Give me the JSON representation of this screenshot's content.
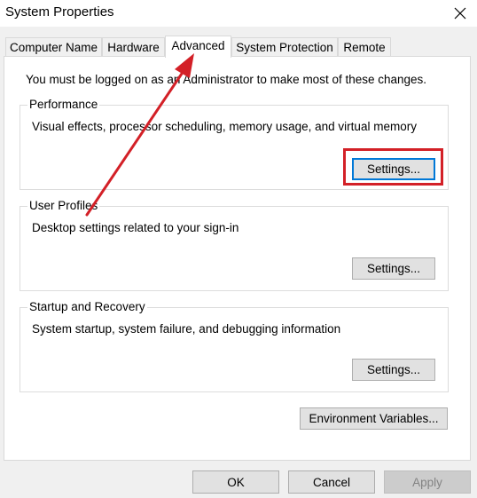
{
  "window": {
    "title": "System Properties",
    "close_icon": "close-icon"
  },
  "tabs": [
    {
      "label": "Computer Name",
      "active": false
    },
    {
      "label": "Hardware",
      "active": false
    },
    {
      "label": "Advanced",
      "active": true
    },
    {
      "label": "System Protection",
      "active": false
    },
    {
      "label": "Remote",
      "active": false
    }
  ],
  "notice": "You must be logged on as an Administrator to make most of these changes.",
  "groups": {
    "performance": {
      "title": "Performance",
      "description": "Visual effects, processor scheduling, memory usage, and virtual memory",
      "button": "Settings..."
    },
    "user_profiles": {
      "title": "User Profiles",
      "description": "Desktop settings related to your sign-in",
      "button": "Settings..."
    },
    "startup_recovery": {
      "title": "Startup and Recovery",
      "description": "System startup, system failure, and debugging information",
      "button": "Settings..."
    }
  },
  "env_button": "Environment Variables...",
  "footer": {
    "ok": "OK",
    "cancel": "Cancel",
    "apply": "Apply"
  },
  "annotation": {
    "color": "#d32027"
  }
}
